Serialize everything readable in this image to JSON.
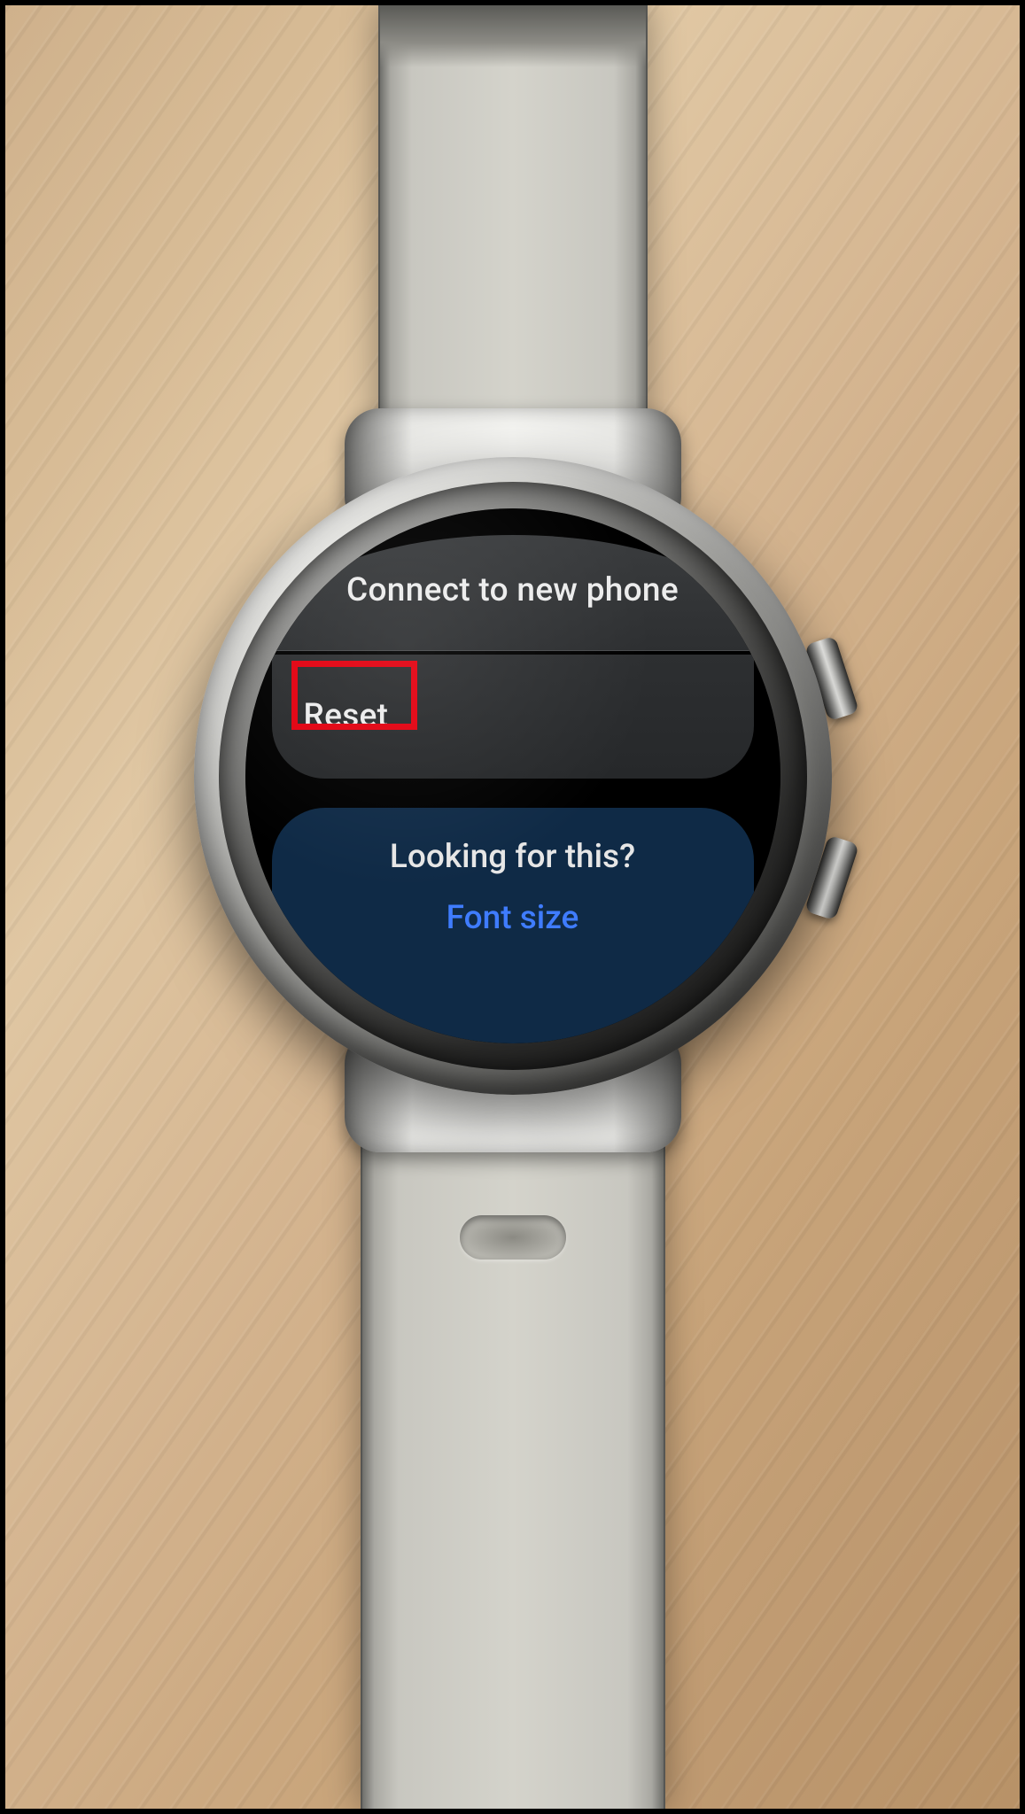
{
  "menu": {
    "connect_label": "Connect to new phone",
    "reset_label": "Reset"
  },
  "tips": {
    "heading": "Looking for this?",
    "link_label": "Font size"
  },
  "highlight": {
    "target": "reset"
  }
}
